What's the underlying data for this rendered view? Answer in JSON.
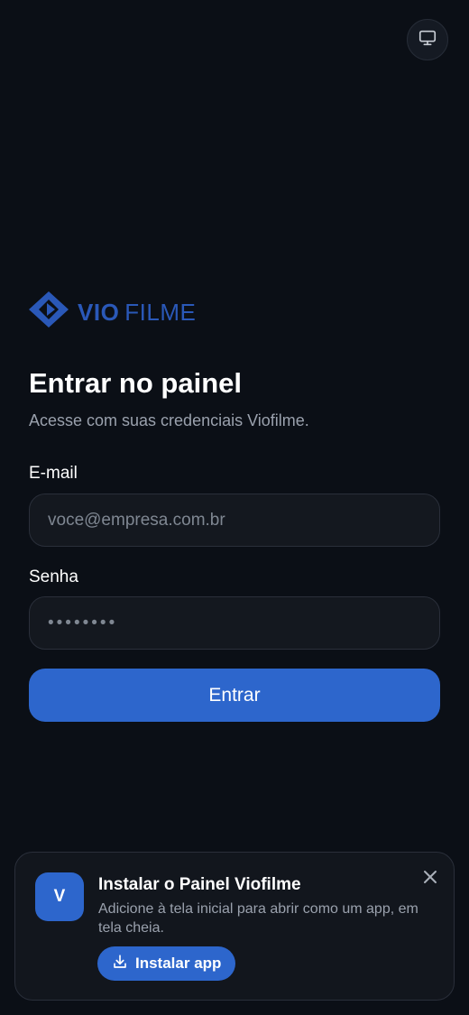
{
  "theme_toggle": {
    "icon": "monitor-icon"
  },
  "brand": {
    "logo_icon": "vio-logo-icon",
    "name_strong": "VIO",
    "name_light": "FILME",
    "color": "#2a58b8"
  },
  "login": {
    "title": "Entrar no painel",
    "subtitle": "Acesse com suas credenciais Viofilme.",
    "email_label": "E-mail",
    "email_placeholder": "voce@empresa.com.br",
    "email_value": "",
    "password_label": "Senha",
    "password_placeholder": "••••••••",
    "password_value": "",
    "submit_label": "Entrar"
  },
  "install_prompt": {
    "avatar_letter": "V",
    "title": "Instalar o Painel Viofilme",
    "description": "Adicione à tela inicial para abrir como um app, em tela cheia.",
    "button_label": "Instalar app",
    "button_icon": "download-icon",
    "close_icon": "close-icon"
  },
  "colors": {
    "background": "#0b0f16",
    "accent": "#2d66cc",
    "muted_text": "#9aa1ad"
  }
}
